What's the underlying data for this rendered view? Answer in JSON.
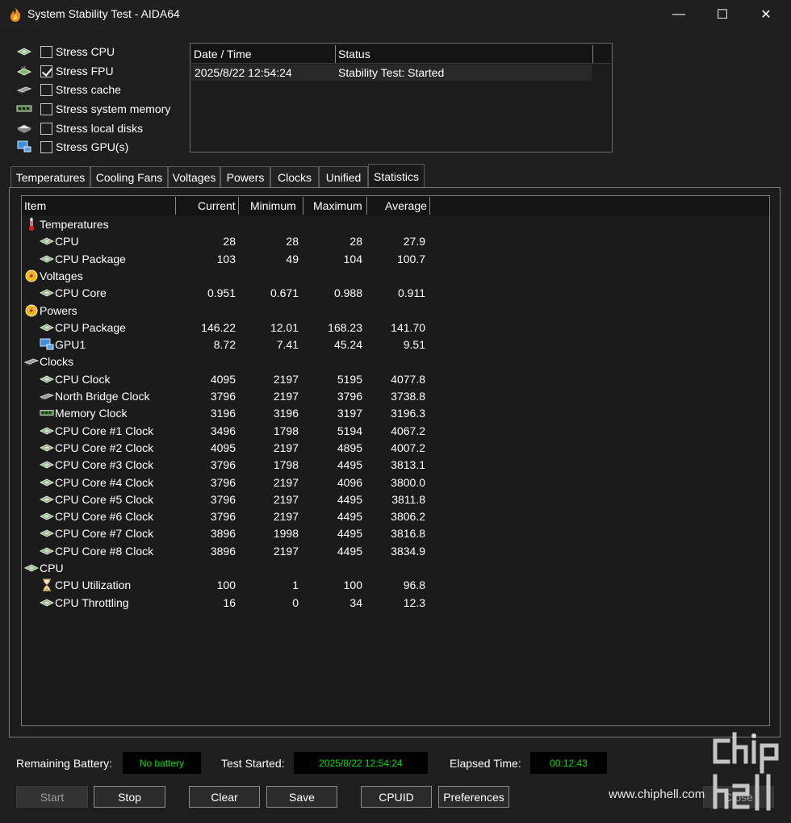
{
  "window": {
    "title": "System Stability Test - AIDA64",
    "minimize_glyph": "—",
    "maximize_glyph": "☐",
    "close_glyph": "✕"
  },
  "stress_options": [
    {
      "label": "Stress CPU",
      "checked": false,
      "icon": "cpu-chip-icon"
    },
    {
      "label": "Stress FPU",
      "checked": true,
      "icon": "fpu-chip-icon"
    },
    {
      "label": "Stress cache",
      "checked": false,
      "icon": "cache-chip-icon"
    },
    {
      "label": "Stress system memory",
      "checked": false,
      "icon": "memory-module-icon"
    },
    {
      "label": "Stress local disks",
      "checked": false,
      "icon": "disk-drive-icon"
    },
    {
      "label": "Stress GPU(s)",
      "checked": false,
      "icon": "gpu-monitor-icon"
    }
  ],
  "log": {
    "columns": [
      "Date / Time",
      "Status"
    ],
    "rows": [
      {
        "datetime": "2025/8/22 12:54:24",
        "status": "Stability Test: Started"
      }
    ]
  },
  "tabs": [
    "Temperatures",
    "Cooling Fans",
    "Voltages",
    "Powers",
    "Clocks",
    "Unified",
    "Statistics"
  ],
  "active_tab": "Statistics",
  "stats": {
    "columns": [
      "Item",
      "Current",
      "Minimum",
      "Maximum",
      "Average"
    ],
    "rows": [
      {
        "type": "group",
        "label": "Temperatures",
        "icon": "thermometer-icon"
      },
      {
        "type": "item",
        "label": "CPU",
        "icon": "cpu-chip-icon",
        "current": "28",
        "minimum": "28",
        "maximum": "28",
        "average": "27.9"
      },
      {
        "type": "item",
        "label": "CPU Package",
        "icon": "cpu-chip-icon",
        "current": "103",
        "minimum": "49",
        "maximum": "104",
        "average": "100.7"
      },
      {
        "type": "group",
        "label": "Voltages",
        "icon": "lightning-icon"
      },
      {
        "type": "item",
        "label": "CPU Core",
        "icon": "cpu-chip-icon",
        "current": "0.951",
        "minimum": "0.671",
        "maximum": "0.988",
        "average": "0.911"
      },
      {
        "type": "group",
        "label": "Powers",
        "icon": "lightning-icon"
      },
      {
        "type": "item",
        "label": "CPU Package",
        "icon": "cpu-chip-icon",
        "current": "146.22",
        "minimum": "12.01",
        "maximum": "168.23",
        "average": "141.70"
      },
      {
        "type": "item",
        "label": "GPU1",
        "icon": "gpu-monitor-icon",
        "current": "8.72",
        "minimum": "7.41",
        "maximum": "45.24",
        "average": "9.51"
      },
      {
        "type": "group",
        "label": "Clocks",
        "icon": "chipset-icon"
      },
      {
        "type": "item",
        "label": "CPU Clock",
        "icon": "cpu-chip-icon",
        "current": "4095",
        "minimum": "2197",
        "maximum": "5195",
        "average": "4077.8"
      },
      {
        "type": "item",
        "label": "North Bridge Clock",
        "icon": "chipset-icon",
        "current": "3796",
        "minimum": "2197",
        "maximum": "3796",
        "average": "3738.8"
      },
      {
        "type": "item",
        "label": "Memory Clock",
        "icon": "memory-module-icon",
        "current": "3196",
        "minimum": "3196",
        "maximum": "3197",
        "average": "3196.3"
      },
      {
        "type": "item",
        "label": "CPU Core #1 Clock",
        "icon": "cpu-chip-icon",
        "current": "3496",
        "minimum": "1798",
        "maximum": "5194",
        "average": "4067.2"
      },
      {
        "type": "item",
        "label": "CPU Core #2 Clock",
        "icon": "cpu-chip-icon",
        "current": "4095",
        "minimum": "2197",
        "maximum": "4895",
        "average": "4007.2"
      },
      {
        "type": "item",
        "label": "CPU Core #3 Clock",
        "icon": "cpu-chip-icon",
        "current": "3796",
        "minimum": "1798",
        "maximum": "4495",
        "average": "3813.1"
      },
      {
        "type": "item",
        "label": "CPU Core #4 Clock",
        "icon": "cpu-chip-icon",
        "current": "3796",
        "minimum": "2197",
        "maximum": "4096",
        "average": "3800.0"
      },
      {
        "type": "item",
        "label": "CPU Core #5 Clock",
        "icon": "cpu-chip-icon",
        "current": "3796",
        "minimum": "2197",
        "maximum": "4495",
        "average": "3811.8"
      },
      {
        "type": "item",
        "label": "CPU Core #6 Clock",
        "icon": "cpu-chip-icon",
        "current": "3796",
        "minimum": "2197",
        "maximum": "4495",
        "average": "3806.2"
      },
      {
        "type": "item",
        "label": "CPU Core #7 Clock",
        "icon": "cpu-chip-icon",
        "current": "3896",
        "minimum": "1998",
        "maximum": "4495",
        "average": "3816.8"
      },
      {
        "type": "item",
        "label": "CPU Core #8 Clock",
        "icon": "cpu-chip-icon",
        "current": "3896",
        "minimum": "2197",
        "maximum": "4495",
        "average": "3834.9"
      },
      {
        "type": "group",
        "label": "CPU",
        "icon": "cpu-chip-icon"
      },
      {
        "type": "item",
        "label": "CPU Utilization",
        "icon": "hourglass-icon",
        "current": "100",
        "minimum": "1",
        "maximum": "100",
        "average": "96.8"
      },
      {
        "type": "item",
        "label": "CPU Throttling",
        "icon": "cpu-chip-icon",
        "current": "16",
        "minimum": "0",
        "maximum": "34",
        "average": "12.3"
      }
    ]
  },
  "status_bar": {
    "battery_label": "Remaining Battery:",
    "battery_value": "No battery",
    "started_label": "Test Started:",
    "started_value": "2025/8/22 12:54:24",
    "elapsed_label": "Elapsed Time:",
    "elapsed_value": "00:12:43",
    "value_color": "#00e000"
  },
  "buttons": {
    "start": "Start",
    "stop": "Stop",
    "clear": "Clear",
    "save": "Save",
    "cpuid": "CPUID",
    "preferences": "Preferences",
    "close": "Close"
  },
  "watermark": {
    "site": "www.chiphell.com",
    "logo_text": "chip hell"
  }
}
